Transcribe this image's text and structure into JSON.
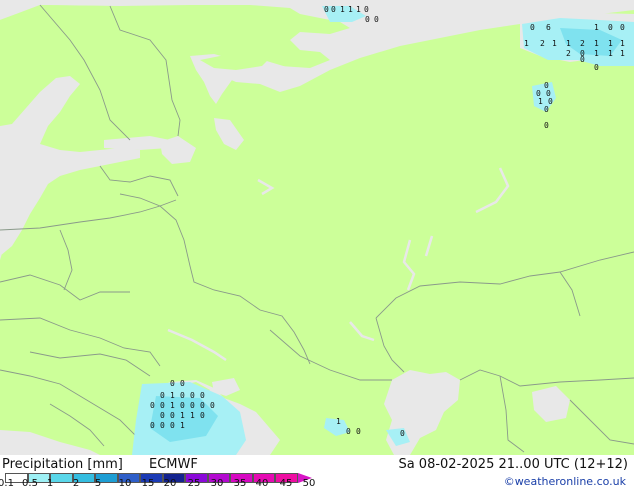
{
  "title": "Precipitation [mm]",
  "model": "ECMWF",
  "valid_time": "Sa 08-02-2025 21..00 UTC (12+12)",
  "credit": "©weatheronline.co.uk",
  "colors": {
    "land": "#ccff99",
    "sea": "#e8e8e8",
    "border": "#8a9a8a",
    "precip_light": "#a7f0f5",
    "precip_mid": "#7fe2ef",
    "arrow": "#d815c6"
  },
  "legend": {
    "ticks": [
      "0.1",
      "0.5",
      "1",
      "2",
      "5",
      "10",
      "15",
      "20",
      "25",
      "30",
      "35",
      "40",
      "45",
      "50"
    ],
    "colors": [
      "#ffffff",
      "#9ef0f5",
      "#5ad7ea",
      "#35bde0",
      "#1e9ed4",
      "#2e5ec8",
      "#1b3ab5",
      "#14238f",
      "#8a09d9",
      "#b309d0",
      "#d608c2",
      "#e50ab3",
      "#ee0da2"
    ]
  },
  "map_labels": {
    "north_sea_top": [
      "0",
      "0",
      "1",
      "1",
      "1",
      "0",
      "0",
      "0"
    ],
    "north_east": [
      "0",
      "6",
      "1",
      "0",
      "0",
      "1",
      "2",
      "1",
      "1",
      "2",
      "1",
      "1",
      "1",
      "1",
      "2",
      "0",
      "1",
      "1",
      "1",
      "0",
      "0"
    ],
    "novaya_zemlya": [
      "0",
      "0",
      "0",
      "1",
      "0",
      "0",
      "0"
    ],
    "black_sea": [
      "0",
      "0",
      "0",
      "1",
      "0",
      "0",
      "0",
      "0",
      "0",
      "1",
      "0",
      "0",
      "0",
      "0",
      "0",
      "0",
      "1",
      "1",
      "0",
      "0",
      "0",
      "0",
      "1"
    ],
    "caspian": [
      "1",
      "0",
      "0",
      "0"
    ]
  }
}
